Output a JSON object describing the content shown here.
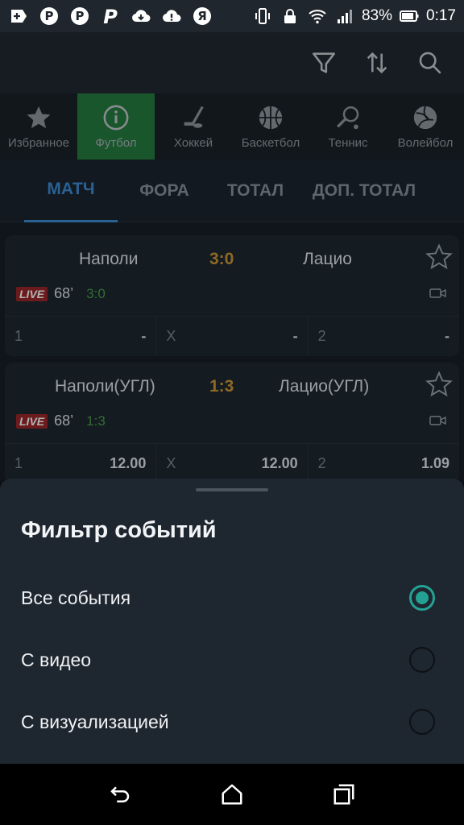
{
  "status_bar": {
    "left_icons": [
      "add-icon",
      "pinterest-icon",
      "pinterest-icon",
      "parking-icon",
      "cloud-icon",
      "cloud-alert-icon",
      "yandex-icon"
    ],
    "battery": "83%",
    "time": "0:17"
  },
  "toolbar": {
    "icons": [
      "filter-icon",
      "sort-icon",
      "search-icon"
    ]
  },
  "sports": [
    {
      "label": "Избранное",
      "icon": "star-icon"
    },
    {
      "label": "Футбол",
      "icon": "info-icon"
    },
    {
      "label": "Хоккей",
      "icon": "hockey-icon"
    },
    {
      "label": "Баскетбол",
      "icon": "basketball-icon"
    },
    {
      "label": "Теннис",
      "icon": "tennis-icon"
    },
    {
      "label": "Волейбол",
      "icon": "volleyball-icon"
    }
  ],
  "market_tabs": [
    "МАТЧ",
    "ФОРА",
    "ТОТАЛ",
    "ДОП. ТОТАЛ"
  ],
  "matches": [
    {
      "home": "Наполи",
      "away": "Лацио",
      "score": "3:0",
      "live": "LIVE",
      "minute": "68’",
      "live_score": "3:0",
      "odds": [
        {
          "label": "1",
          "value": "-"
        },
        {
          "label": "X",
          "value": "-"
        },
        {
          "label": "2",
          "value": "-"
        }
      ]
    },
    {
      "home": "Наполи(УГЛ)",
      "away": "Лацио(УГЛ)",
      "score": "1:3",
      "live": "LIVE",
      "minute": "68’",
      "live_score": "1:3",
      "odds": [
        {
          "label": "1",
          "value": "12.00"
        },
        {
          "label": "X",
          "value": "12.00"
        },
        {
          "label": "2",
          "value": "1.09"
        }
      ]
    }
  ],
  "sheet": {
    "title": "Фильтр событий",
    "options": [
      {
        "label": "Все события",
        "selected": true
      },
      {
        "label": "С видео",
        "selected": false
      },
      {
        "label": "С визуализацией",
        "selected": false
      }
    ]
  },
  "colors": {
    "accent": "#23a293",
    "score": "#b9862a",
    "tab_active": "#2f6ea8",
    "sport_active": "#1f8a3a"
  }
}
